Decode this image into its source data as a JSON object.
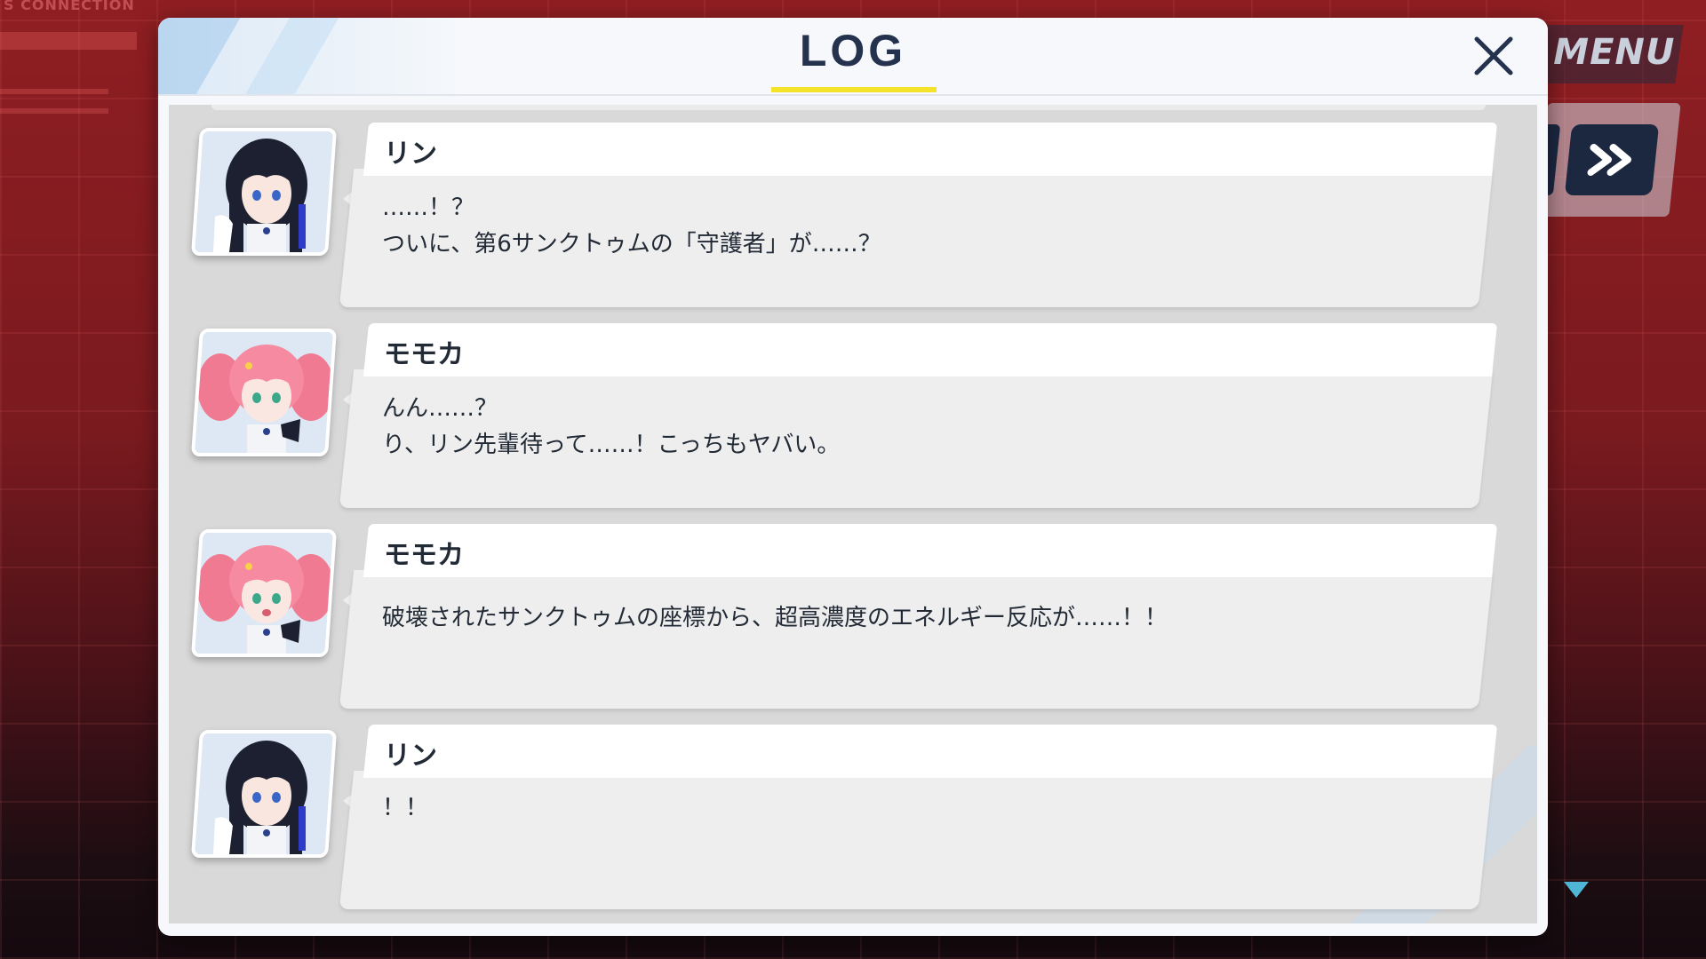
{
  "hud": {
    "label": "S CONNECTION"
  },
  "menu": {
    "label": "MENU",
    "skip_icon": "fast-forward-icon"
  },
  "dialog": {
    "title": "LOG",
    "close_icon": "close-icon",
    "entries": [
      {
        "speaker": "リン",
        "avatar": "rin-portrait",
        "lines": [
          "……！？",
          "ついに、第6サンクトゥムの「守護者」が……？"
        ]
      },
      {
        "speaker": "モモカ",
        "avatar": "momoka-portrait",
        "lines": [
          "んん……？",
          "り、リン先輩待って……！こっちもヤバい。"
        ]
      },
      {
        "speaker": "モモカ",
        "avatar": "momoka-portrait",
        "lines": [
          "破壊されたサンクトゥムの座標から、超高濃度のエネルギー反応が……！！"
        ]
      },
      {
        "speaker": "リン",
        "avatar": "rin-portrait",
        "lines": [
          "！！"
        ]
      }
    ]
  },
  "colors": {
    "background_red": "#8f1e22",
    "title_text": "#24324e",
    "title_underline": "#f5e32a",
    "skip_button": "#1c2740",
    "scroll_arrow": "#4fb6d6"
  }
}
